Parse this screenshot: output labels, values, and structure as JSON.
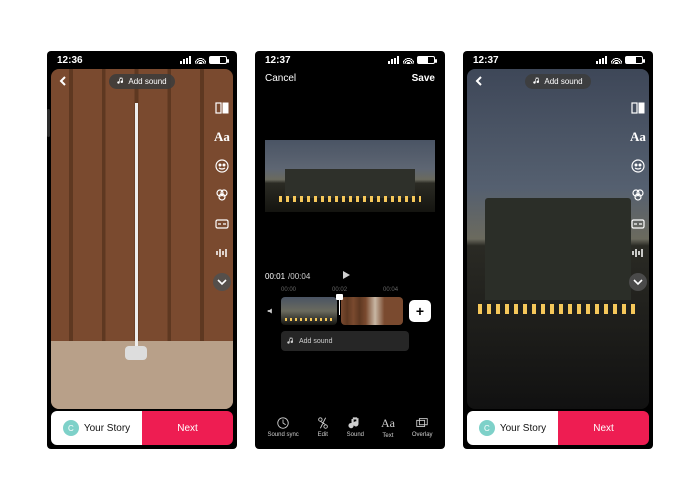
{
  "status": {
    "time1": "12:36",
    "time2": "12:37",
    "time3": "12:37",
    "battery_label": "56"
  },
  "add_sound_label": "Add sound",
  "story_button": "Your Story",
  "story_avatar_initial": "C",
  "next_button": "Next",
  "editor": {
    "cancel": "Cancel",
    "save": "Save",
    "time_current": "00:01",
    "time_total": "/00:04",
    "ticks": [
      "00:00",
      "00:02",
      "00:04"
    ],
    "add_sound_row": "Add sound"
  },
  "right_tools": {
    "text_label": "Aa"
  },
  "tabs": [
    {
      "id": "sound-sync",
      "label": "Sound sync"
    },
    {
      "id": "edit",
      "label": "Edit"
    },
    {
      "id": "sound",
      "label": "Sound"
    },
    {
      "id": "text",
      "label": "Text"
    },
    {
      "id": "overlay",
      "label": "Overlay"
    }
  ]
}
